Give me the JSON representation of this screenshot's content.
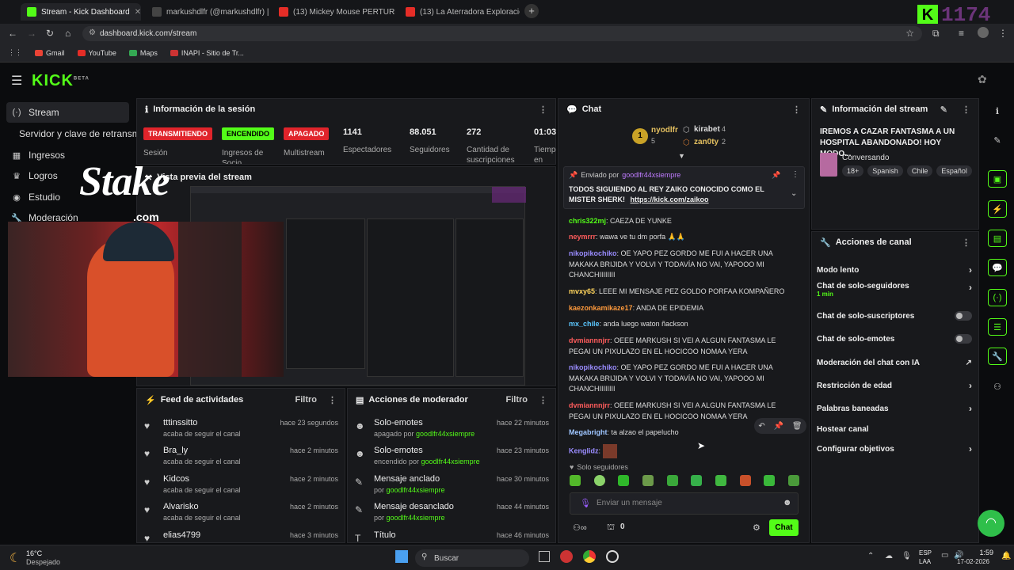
{
  "browser": {
    "tabs": [
      {
        "label": "Stream - Kick Dashboard",
        "color": "#53fc18"
      },
      {
        "label": "markushdlfr (@markushdlfr) | ...",
        "color": "#444"
      },
      {
        "label": "(13) Mickey Mouse PERTURBA...",
        "color": "#e52d27"
      },
      {
        "label": "(13) La Aterradora Exploración...",
        "color": "#e52d27"
      }
    ],
    "url": "dashboard.kick.com/stream",
    "bookmarks": [
      "Gmail",
      "YouTube",
      "Maps",
      "INAPI - Sitio de Tr..."
    ]
  },
  "overlay": {
    "kick_counter": "1174",
    "stake": "Stake",
    "stake_com": ".com"
  },
  "header": {
    "logo": "KICK",
    "beta": "BETA"
  },
  "sidebar": {
    "items": [
      {
        "label": "Stream",
        "icon": "(·)"
      },
      {
        "label": "Servidor y clave de retransmisión",
        "icon": ""
      },
      {
        "label": "Ingresos",
        "icon": "▦"
      },
      {
        "label": "Logros",
        "icon": "♛"
      },
      {
        "label": "Estudio",
        "icon": "◉"
      },
      {
        "label": "Moderación",
        "icon": "🔧"
      }
    ]
  },
  "session": {
    "title": "Información de la sesión",
    "badges": [
      {
        "label": "TRANSMITIENDO",
        "sub": "Sesión",
        "color": "#e0242b"
      },
      {
        "label": "ENCENDIDO",
        "sub": "Ingresos de Socio",
        "color": "#53fc18"
      },
      {
        "label": "APAGADO",
        "sub": "Multistream",
        "color": "#e0242b"
      }
    ],
    "stats": [
      {
        "value": "1141",
        "label": "Espectadores"
      },
      {
        "value": "88.051",
        "label": "Seguidores"
      },
      {
        "value": "272",
        "label": "Cantidad de suscripciones"
      },
      {
        "value": "01:03",
        "label": "Tiempo en vivo"
      }
    ]
  },
  "preview": {
    "title": "Vista previa del stream"
  },
  "feed": {
    "title": "Feed de actividades",
    "filter": "Filtro",
    "items": [
      {
        "name": "tttinssitto",
        "sub": "acaba de seguir el canal",
        "time": "hace 23 segundos"
      },
      {
        "name": "Bra_ly",
        "sub": "acaba de seguir el canal",
        "time": "hace 2 minutos"
      },
      {
        "name": "Kidcos",
        "sub": "acaba de seguir el canal",
        "time": "hace 2 minutos"
      },
      {
        "name": "Alvarisko",
        "sub": "acaba de seguir el canal",
        "time": "hace 2 minutos"
      },
      {
        "name": "elias4799",
        "sub": "",
        "time": "hace 3 minutos"
      }
    ]
  },
  "modactions": {
    "title": "Acciones de moderador",
    "filter": "Filtro",
    "items": [
      {
        "name": "Solo-emotes",
        "pre": "apagado por ",
        "user": "goodlfr44xsiempre",
        "time": "hace 22 minutos",
        "icon": "☻"
      },
      {
        "name": "Solo-emotes",
        "pre": "encendido por ",
        "user": "goodlfr44xsiempre",
        "time": "hace 23 minutos",
        "icon": "☻"
      },
      {
        "name": "Mensaje anclado",
        "pre": "por ",
        "user": "goodlfr44xsiempre",
        "time": "hace 30 minutos",
        "icon": "✎"
      },
      {
        "name": "Mensaje desanclado",
        "pre": "por ",
        "user": "goodlfr44xsiempre",
        "time": "hace 44 minutos",
        "icon": "✎"
      },
      {
        "name": "Título",
        "pre": "",
        "user": "",
        "time": "hace 46 minutos",
        "icon": "T"
      }
    ]
  },
  "chat": {
    "title": "Chat",
    "leaders": [
      {
        "rank": "1",
        "name": "nyodlfr",
        "count": "5"
      },
      {
        "name": "kirabet",
        "count": "4"
      },
      {
        "name": "zan0ty",
        "count": "2"
      }
    ],
    "pinned": {
      "sender_prefix": "Enviado por",
      "sender": "goodlfr44xsiempre",
      "text": "TODOS SIGUIENDO AL REY ZAIKO CONOCIDO COMO EL MISTER SHERK!",
      "link": "https://kick.com/zaikoo"
    },
    "messages": [
      {
        "user": "chris322mj",
        "color": "#9ec5ff",
        "text": "CAEZA DE YUNKE"
      },
      {
        "user": "neymrrr",
        "color": "#ff5c5c",
        "text": "wawa ve tu dm porfa 🙏🙏"
      },
      {
        "user": "nikopikochiko",
        "color": "#9a8cff",
        "text": "OE YAPO PEZ GORDO ME FUI A HACER UNA MAKAKA BRIJIDA Y VOLVI Y TODAVÍA NO VAI, YAPOOO MI CHANCHIIIIIIII"
      },
      {
        "user": "mvxy65",
        "color": "#ffd45c",
        "text": "LEEE MI MENSAJE PEZ GOLDO PORFAA KOMPAÑERO"
      },
      {
        "user": "kaezonkamikaze17",
        "color": "#ff9a3c",
        "text": "ANDA DE EPIDEMIA"
      },
      {
        "user": "mx_chile",
        "color": "#5cc8ff",
        "text": "anda luego waton ñackson"
      },
      {
        "user": "dvmiannnjrr",
        "color": "#ff5c5c",
        "text": "OEEE MARKUSH SI VEI A ALGUN FANTASMA LE PEGAI UN PIXULAZO EN EL HOCICOO NOMAA YERA"
      },
      {
        "user": "nikopikochiko",
        "color": "#9a8cff",
        "text": "OE YAPO PEZ GORDO ME FUI A HACER UNA MAKAKA BRIJIDA Y VOLVI Y TODAVÍA NO VAI, YAPOOO MI CHANCHIIIIIIII"
      },
      {
        "user": "dvmiannnjrr",
        "color": "#ff5c5c",
        "text": "OEEE MARKUSH SI VEI A ALGUN FANTASMA LE PEGAI UN PIXULAZO EN EL HOCICOO NOMAA YERA"
      },
      {
        "user": "Megabright",
        "color": "#9ec5ff",
        "text": "ta alzao el papelucho"
      },
      {
        "user": "Kenglidz",
        "color": "#9a8cff",
        "text": ""
      }
    ],
    "followers_only": "Solo seguidores",
    "placeholder": "Enviar un mensaje",
    "bottom_count": "0",
    "send": "Chat"
  },
  "streaminfo": {
    "title": "Información del stream",
    "stream_title": "IREMOS A CAZAR FANTASMA A UN HOSPITAL ABANDONADO! HOY MODO...",
    "category": "Conversando",
    "tags": [
      "18+",
      "Spanish",
      "Chile",
      "Español"
    ]
  },
  "channel_actions": {
    "title": "Acciones de canal",
    "items": [
      {
        "label": "Modo lento",
        "kind": "chevron"
      },
      {
        "label": "Chat de solo-seguidores",
        "sub": "1 min",
        "kind": "chevron"
      },
      {
        "label": "Chat de solo-suscriptores",
        "kind": "toggle"
      },
      {
        "label": "Chat de solo-emotes",
        "kind": "toggle"
      },
      {
        "label": "Moderación del chat con IA",
        "kind": "external"
      },
      {
        "label": "Restricción de edad",
        "kind": "chevron"
      },
      {
        "label": "Palabras baneadas",
        "kind": "chevron"
      },
      {
        "label": "Hostear canal",
        "kind": "none"
      },
      {
        "label": "Configurar objetivos",
        "kind": "chevron"
      }
    ]
  },
  "taskbar": {
    "temp": "16°C",
    "weather": "Despejado",
    "search": "Buscar",
    "lang": "ESP",
    "lang2": "LAA",
    "time": "1:59",
    "date": "17-02-2026"
  }
}
